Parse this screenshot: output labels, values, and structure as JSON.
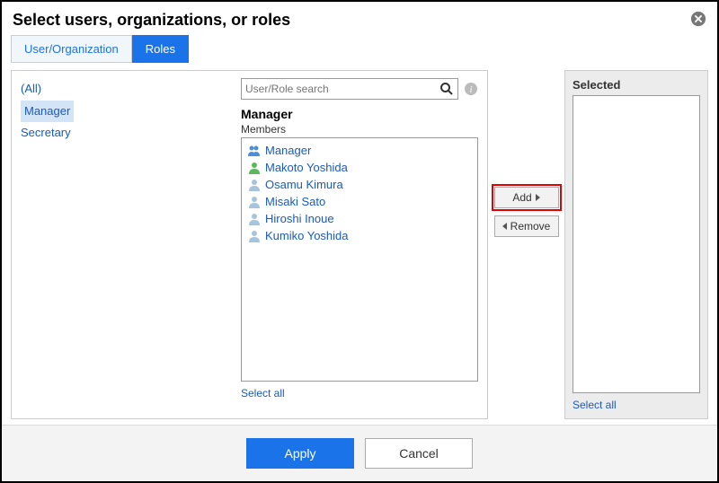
{
  "header": {
    "title": "Select users, organizations, or roles"
  },
  "tabs": [
    {
      "label": "User/Organization",
      "active": false
    },
    {
      "label": "Roles",
      "active": true
    }
  ],
  "sidebar": {
    "items": [
      "(All)",
      "Manager",
      "Secretary"
    ],
    "selected": "Manager"
  },
  "search": {
    "placeholder": "User/Role search"
  },
  "members": {
    "group": "Manager",
    "subtitle": "Members",
    "list": [
      {
        "name": "Manager",
        "icon": "group",
        "color": "#4a90d9"
      },
      {
        "name": "Makoto Yoshida",
        "icon": "user",
        "color": "#5cb85c"
      },
      {
        "name": "Osamu Kimura",
        "icon": "user",
        "color": "#a8c4dd"
      },
      {
        "name": "Misaki Sato",
        "icon": "user",
        "color": "#a8c4dd"
      },
      {
        "name": "Hiroshi Inoue",
        "icon": "user",
        "color": "#a8c4dd"
      },
      {
        "name": "Kumiko Yoshida",
        "icon": "user",
        "color": "#a8c4dd"
      }
    ],
    "select_all": "Select all"
  },
  "buttons": {
    "add": "Add",
    "remove": "Remove",
    "highlighted": "add"
  },
  "selected": {
    "title": "Selected",
    "items": [],
    "select_all": "Select all"
  },
  "footer": {
    "apply": "Apply",
    "cancel": "Cancel"
  },
  "colors": {
    "primary": "#1a73e8",
    "link": "#1a5ab8",
    "highlight_outline": "#e40000"
  }
}
